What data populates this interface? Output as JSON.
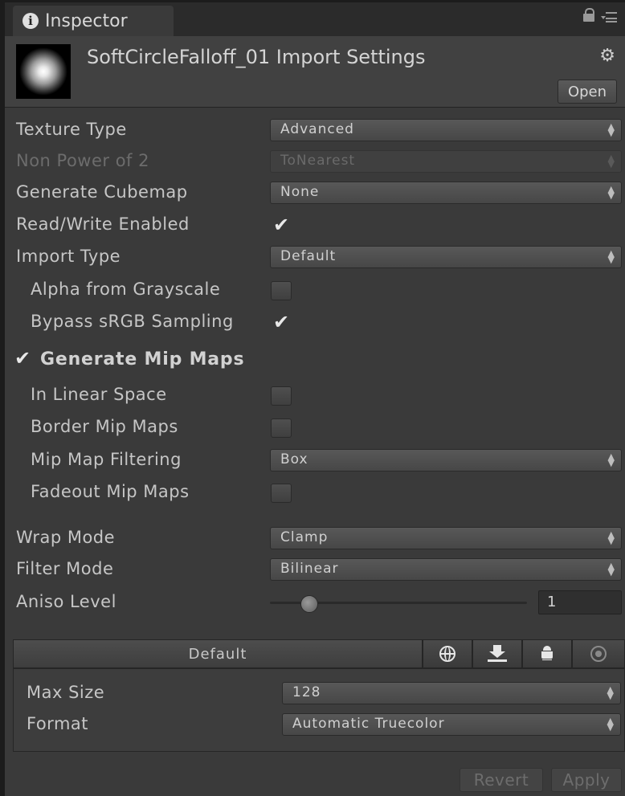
{
  "tab": {
    "title": "Inspector"
  },
  "header": {
    "asset_title": "SoftCircleFalloff_01 Import Settings",
    "open_label": "Open"
  },
  "fields": {
    "texture_type": {
      "label": "Texture Type",
      "value": "Advanced"
    },
    "non_power_of_2": {
      "label": "Non Power of 2",
      "value": "ToNearest",
      "disabled": true
    },
    "generate_cubemap": {
      "label": "Generate Cubemap",
      "value": "None"
    },
    "read_write_enabled": {
      "label": "Read/Write Enabled",
      "checked": true
    },
    "import_type": {
      "label": "Import Type",
      "value": "Default"
    },
    "alpha_from_grayscale": {
      "label": "Alpha from Grayscale",
      "checked": false
    },
    "bypass_srgb_sampling": {
      "label": "Bypass sRGB Sampling",
      "checked": true
    },
    "generate_mip_maps": {
      "label": "Generate Mip Maps",
      "checked": true
    },
    "in_linear_space": {
      "label": "In Linear Space",
      "checked": false
    },
    "border_mip_maps": {
      "label": "Border Mip Maps",
      "checked": false
    },
    "mip_map_filtering": {
      "label": "Mip Map Filtering",
      "value": "Box"
    },
    "fadeout_mip_maps": {
      "label": "Fadeout Mip Maps",
      "checked": false
    },
    "wrap_mode": {
      "label": "Wrap Mode",
      "value": "Clamp"
    },
    "filter_mode": {
      "label": "Filter Mode",
      "value": "Bilinear"
    },
    "aniso_level": {
      "label": "Aniso Level",
      "value": "1",
      "slider_fraction": 0.12
    }
  },
  "platform": {
    "tabs": [
      {
        "label": "Default",
        "icon": "none"
      },
      {
        "icon": "globe-icon"
      },
      {
        "icon": "download-icon"
      },
      {
        "icon": "android-icon"
      },
      {
        "icon": "console-icon"
      }
    ],
    "max_size": {
      "label": "Max Size",
      "value": "128"
    },
    "format": {
      "label": "Format",
      "value": "Automatic Truecolor"
    }
  },
  "footer": {
    "revert_label": "Revert",
    "apply_label": "Apply"
  }
}
